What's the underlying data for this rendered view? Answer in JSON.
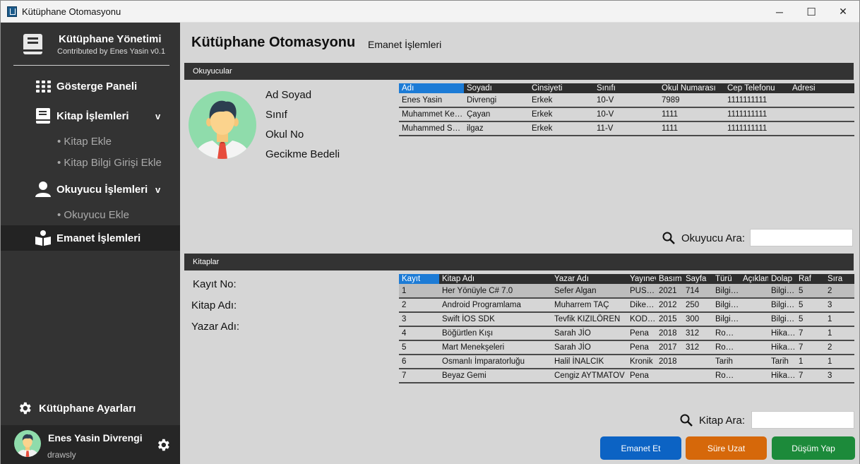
{
  "window": {
    "title": "Kütüphane Otomasyonu",
    "minimize": "─",
    "maximize": "☐",
    "close": "✕"
  },
  "sidebar": {
    "brand_title": "Kütüphane Yönetimi",
    "brand_sub": "Contributed by Enes Yasin v0.1",
    "nav": {
      "dashboard": "Gösterge Paneli",
      "books": "Kitap İşlemleri",
      "add_book": "• Kitap Ekle",
      "add_book_info": "• Kitap Bilgi Girişi Ekle",
      "readers": "Okuyucu İşlemleri",
      "add_reader": "• Okuyucu Ekle",
      "loans": "Emanet İşlemleri",
      "chevron": "v"
    },
    "settings": "Kütüphane Ayarları",
    "user": {
      "name": "Enes Yasin Divrengi",
      "handle": "drawsly"
    }
  },
  "main": {
    "title": "Kütüphane Otomasyonu",
    "subtitle": "Emanet İşlemleri",
    "readers_section": "Okuyucular",
    "reader_info": {
      "name": "Ad Soyad",
      "class": "Sınıf",
      "school_no": "Okul No",
      "penalty": "Gecikme Bedeli"
    },
    "readers_table": {
      "columns": [
        "Adı",
        "Soyadı",
        "Cinsiyeti",
        "Sınıfı",
        "Okul Numarası",
        "Cep Telefonu",
        "Adresi"
      ],
      "rows": [
        [
          "Enes Yasin",
          "Divrengi",
          "Erkek",
          "10-V",
          "7989",
          "1111111111",
          ""
        ],
        [
          "Muhammet Kerem",
          "Çayan",
          "Erkek",
          "10-V",
          "1111",
          "1111111111",
          ""
        ],
        [
          "Muhammed Selim",
          "ilgaz",
          "Erkek",
          "11-V",
          "1111",
          "1111111111",
          ""
        ]
      ]
    },
    "reader_search": {
      "label": "Okuyucu Ara:",
      "value": ""
    },
    "books_section": "Kitaplar",
    "book_info": {
      "record_no": "Kayıt No:",
      "book_name": "Kitap Adı:",
      "author": "Yazar Adı:"
    },
    "books_table": {
      "columns": [
        "Kayıt",
        "Kitap Adı",
        "Yazar Adı",
        "Yayınevi",
        "Basım",
        "Sayfa",
        "Türü",
        "Açıklama",
        "Dolap",
        "Raf",
        "Sıra"
      ],
      "rows": [
        [
          "1",
          "Her Yönüyle C# 7.0",
          "Sefer Algan",
          "PUSULA",
          "2021",
          "714",
          "Bilgisayar",
          "",
          "Bilgisayar",
          "5",
          "2"
        ],
        [
          "2",
          "Android Programlama",
          "Muharrem TAÇ",
          "Dikeyeksen",
          "2012",
          "250",
          "Bilgisayar",
          "",
          "Bilgisayar",
          "5",
          "3"
        ],
        [
          "3",
          "Swift İOS SDK",
          "Tevfik KIZILÖREN",
          "KODLAB",
          "2015",
          "300",
          "Bilgisayar",
          "",
          "Bilgisayar",
          "5",
          "1"
        ],
        [
          "4",
          "Böğürtlen Kışı",
          "Sarah JİO",
          "Pena",
          "2018",
          "312",
          "Roman",
          "",
          "Hikaye",
          "7",
          "1"
        ],
        [
          "5",
          "Mart Menekşeleri",
          "Sarah JİO",
          "Pena",
          "2017",
          "312",
          "Roman",
          "",
          "Hikaye",
          "7",
          "2"
        ],
        [
          "6",
          "Osmanlı İmparatorluğu",
          "Halil İNALCIK",
          "Kronik",
          "2018",
          "",
          "Tarih",
          "",
          "Tarih",
          "1",
          "1"
        ],
        [
          "7",
          "Beyaz Gemi",
          "Cengiz AYTMATOV",
          "Pena",
          "",
          "",
          "Roman",
          "",
          "Hikaye",
          "7",
          "3"
        ]
      ]
    },
    "book_search": {
      "label": "Kitap Ara:",
      "value": ""
    },
    "buttons": {
      "loan": "Emanet Et",
      "extend": "Süre Uzat",
      "drop": "Düşüm Yap"
    },
    "colors": {
      "loan": "#0c63c4",
      "extend": "#d6680a",
      "drop": "#1c8a3a",
      "header": "#333333",
      "accent": "#1c7bd6"
    }
  }
}
